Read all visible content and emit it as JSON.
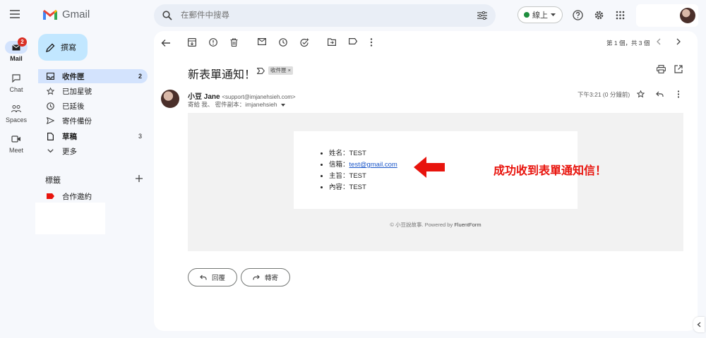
{
  "app": {
    "name": "Gmail"
  },
  "rail": [
    {
      "key": "mail",
      "label": "Mail",
      "icon": "mail-icon",
      "badge": "2",
      "active": true
    },
    {
      "key": "chat",
      "label": "Chat",
      "icon": "chat-icon"
    },
    {
      "key": "spaces",
      "label": "Spaces",
      "icon": "spaces-icon"
    },
    {
      "key": "meet",
      "label": "Meet",
      "icon": "meet-icon"
    }
  ],
  "search": {
    "placeholder": "在郵件中搜尋"
  },
  "status": {
    "label": "線上"
  },
  "compose": {
    "label": "撰寫"
  },
  "nav": [
    {
      "label": "收件匣",
      "icon": "inbox-icon",
      "count": "2"
    },
    {
      "label": "已加星號",
      "icon": "star-icon",
      "count": ""
    },
    {
      "label": "已延後",
      "icon": "clock-icon",
      "count": ""
    },
    {
      "label": "寄件備份",
      "icon": "send-icon",
      "count": ""
    },
    {
      "label": "草稿",
      "icon": "draft-icon",
      "count": "3"
    },
    {
      "label": "更多",
      "icon": "chevron-down-icon",
      "count": ""
    }
  ],
  "labels": {
    "title": "標籤",
    "items": [
      {
        "label": "合作邀約",
        "color": "#e8140d"
      }
    ]
  },
  "toolbar": {
    "pagination": "第 1 個，共 3 個"
  },
  "email": {
    "subject": "新表單通知！",
    "label_chip": "收件匣 ×",
    "sender_name": "小豆 Jane",
    "sender_email": "<support@imjanehsieh.com>",
    "to_line": "寄給 我、 密件副本：imjanehsieh",
    "time": "下午3:21 (0 分鐘前)",
    "fields": [
      {
        "label": "姓名：",
        "value": "TEST",
        "link": false
      },
      {
        "label": "信箱：",
        "value": "test@gmail.com",
        "link": true
      },
      {
        "label": "主旨：",
        "value": "TEST",
        "link": false
      },
      {
        "label": "內容：",
        "value": "TEST",
        "link": false
      }
    ],
    "footer_prefix": "© 小豆說故事. Powered by ",
    "footer_brand": "FluentForm",
    "callout": "成功收到表單通知信！",
    "accent_color": "#e8140d"
  },
  "actions": {
    "reply": "回覆",
    "forward": "轉寄"
  }
}
